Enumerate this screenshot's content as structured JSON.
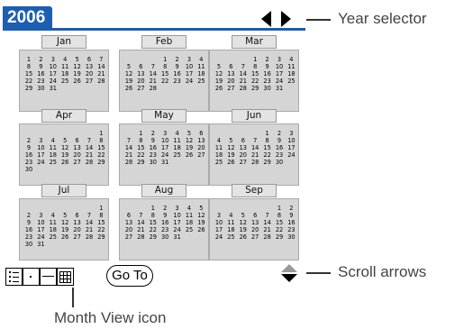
{
  "header": {
    "year": "2006"
  },
  "months": [
    {
      "name": "Jan",
      "rows": [
        [
          "",
          "1",
          "2",
          "3",
          "4",
          "5",
          "6",
          "7"
        ],
        [
          "",
          "8",
          "9",
          "10",
          "11",
          "12",
          "13",
          "14"
        ],
        [
          "",
          "15",
          "16",
          "17",
          "18",
          "19",
          "20",
          "21"
        ],
        [
          "",
          "22",
          "23",
          "24",
          "25",
          "26",
          "27",
          "28"
        ],
        [
          "",
          "29",
          "30",
          "31",
          "",
          "",
          "",
          ""
        ]
      ]
    },
    {
      "name": "Feb",
      "rows": [
        [
          "",
          "",
          "",
          "",
          "1",
          "2",
          "3",
          "4"
        ],
        [
          "",
          "5",
          "6",
          "7",
          "8",
          "9",
          "10",
          "11"
        ],
        [
          "",
          "12",
          "13",
          "14",
          "15",
          "16",
          "17",
          "18"
        ],
        [
          "",
          "19",
          "20",
          "21",
          "22",
          "23",
          "24",
          "25"
        ],
        [
          "",
          "26",
          "27",
          "28",
          "",
          "",
          "",
          ""
        ]
      ]
    },
    {
      "name": "Mar",
      "rows": [
        [
          "",
          "",
          "",
          "",
          "1",
          "2",
          "3",
          "4"
        ],
        [
          "",
          "5",
          "6",
          "7",
          "8",
          "9",
          "10",
          "11"
        ],
        [
          "",
          "12",
          "13",
          "14",
          "15",
          "16",
          "17",
          "18"
        ],
        [
          "",
          "19",
          "20",
          "21",
          "22",
          "23",
          "24",
          "25"
        ],
        [
          "",
          "26",
          "27",
          "28",
          "29",
          "30",
          "31",
          ""
        ]
      ]
    },
    {
      "name": "Apr",
      "rows": [
        [
          "",
          "",
          "",
          "",
          "",
          "",
          "",
          "1"
        ],
        [
          "",
          "2",
          "3",
          "4",
          "5",
          "6",
          "7",
          "8"
        ],
        [
          "",
          "9",
          "10",
          "11",
          "12",
          "13",
          "14",
          "15"
        ],
        [
          "",
          "16",
          "17",
          "18",
          "19",
          "20",
          "21",
          "22"
        ],
        [
          "",
          "23",
          "24",
          "25",
          "26",
          "27",
          "28",
          "29"
        ],
        [
          "",
          "30",
          "",
          "",
          "",
          "",
          "",
          ""
        ]
      ]
    },
    {
      "name": "May",
      "rows": [
        [
          "",
          "",
          "1",
          "2",
          "3",
          "4",
          "5",
          "6"
        ],
        [
          "",
          "7",
          "8",
          "9",
          "10",
          "11",
          "12",
          "13"
        ],
        [
          "",
          "14",
          "15",
          "16",
          "17",
          "18",
          "19",
          "20"
        ],
        [
          "",
          "21",
          "22",
          "23",
          "24",
          "25",
          "26",
          "27"
        ],
        [
          "",
          "28",
          "29",
          "30",
          "31",
          "",
          "",
          ""
        ]
      ]
    },
    {
      "name": "Jun",
      "rows": [
        [
          "",
          "",
          "",
          "",
          "",
          "1",
          "2",
          "3"
        ],
        [
          "",
          "4",
          "5",
          "6",
          "7",
          "8",
          "9",
          "10"
        ],
        [
          "",
          "11",
          "12",
          "13",
          "14",
          "15",
          "16",
          "17"
        ],
        [
          "",
          "18",
          "19",
          "20",
          "21",
          "22",
          "23",
          "24"
        ],
        [
          "",
          "25",
          "26",
          "27",
          "28",
          "29",
          "30",
          ""
        ]
      ]
    },
    {
      "name": "Jul",
      "rows": [
        [
          "",
          "",
          "",
          "",
          "",
          "",
          "",
          "1"
        ],
        [
          "",
          "2",
          "3",
          "4",
          "5",
          "6",
          "7",
          "8"
        ],
        [
          "",
          "9",
          "10",
          "11",
          "12",
          "13",
          "14",
          "15"
        ],
        [
          "",
          "16",
          "17",
          "18",
          "19",
          "20",
          "21",
          "22"
        ],
        [
          "",
          "23",
          "24",
          "25",
          "26",
          "27",
          "28",
          "29"
        ],
        [
          "",
          "30",
          "31",
          "",
          "",
          "",
          "",
          ""
        ]
      ]
    },
    {
      "name": "Aug",
      "rows": [
        [
          "",
          "",
          "",
          "1",
          "2",
          "3",
          "4",
          "5"
        ],
        [
          "",
          "6",
          "7",
          "8",
          "9",
          "10",
          "11",
          "12"
        ],
        [
          "",
          "13",
          "14",
          "15",
          "16",
          "17",
          "18",
          "19"
        ],
        [
          "",
          "20",
          "21",
          "22",
          "23",
          "24",
          "25",
          "26"
        ],
        [
          "",
          "27",
          "28",
          "29",
          "30",
          "31",
          "",
          ""
        ]
      ]
    },
    {
      "name": "Sep",
      "rows": [
        [
          "",
          "",
          "",
          "",
          "",
          "",
          "1",
          "2"
        ],
        [
          "",
          "3",
          "4",
          "5",
          "6",
          "7",
          "8",
          "9"
        ],
        [
          "",
          "10",
          "11",
          "12",
          "13",
          "14",
          "15",
          "16"
        ],
        [
          "",
          "17",
          "18",
          "19",
          "20",
          "21",
          "22",
          "23"
        ],
        [
          "",
          "24",
          "25",
          "26",
          "27",
          "28",
          "29",
          "30"
        ]
      ]
    }
  ],
  "toolbar": {
    "goto_label": "Go To"
  },
  "callouts": {
    "year_selector": "Year selector",
    "scroll_arrows": "Scroll arrows",
    "month_view_icon": "Month View icon"
  },
  "colors": {
    "title_blue": "#1b5fb0",
    "month_box": "#d5d5d5"
  }
}
